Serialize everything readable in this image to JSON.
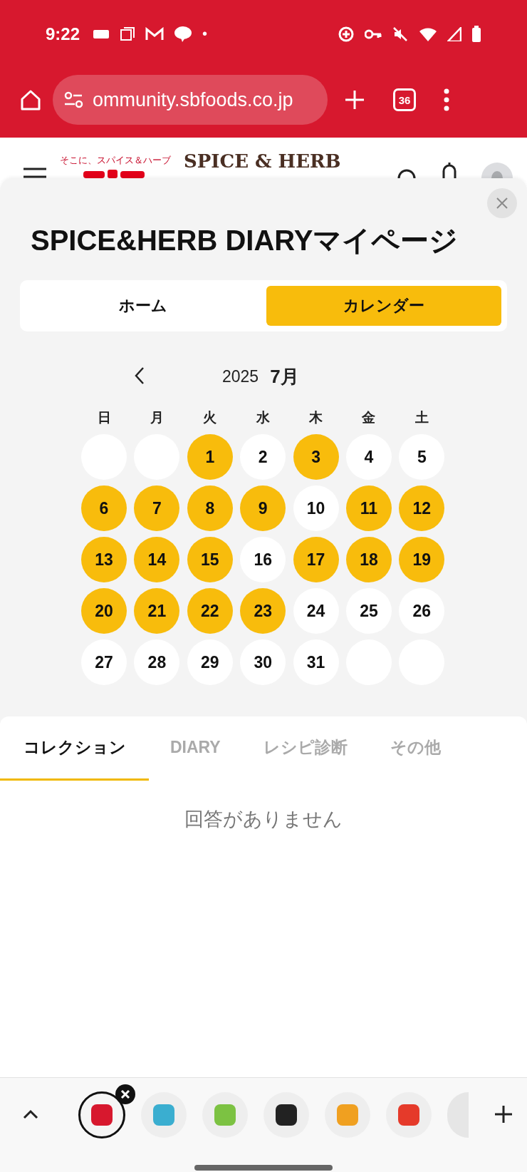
{
  "status_bar": {
    "time": "9:22",
    "notification_dot": "•"
  },
  "browser": {
    "url": "ommunity.sbfoods.co.jp",
    "tab_count": "36"
  },
  "site_header": {
    "tagline": "そこに、スパイス＆ハーブ",
    "brand": "SPICE & HERB"
  },
  "sheet": {
    "title": "SPICE&HERB DIARYマイページ",
    "segments": [
      {
        "label": "ホーム",
        "selected": false
      },
      {
        "label": "カレンダー",
        "selected": true
      }
    ],
    "calendar": {
      "year": "2025",
      "month": "7月",
      "weekdays": [
        "日",
        "月",
        "火",
        "水",
        "木",
        "金",
        "土"
      ],
      "days": [
        {
          "kind": "blank"
        },
        {
          "kind": "blank"
        },
        {
          "kind": "day",
          "day": "1",
          "marked": true
        },
        {
          "kind": "day",
          "day": "2",
          "marked": false
        },
        {
          "kind": "day",
          "day": "3",
          "marked": true
        },
        {
          "kind": "day",
          "day": "4",
          "marked": false
        },
        {
          "kind": "day",
          "day": "5",
          "marked": false
        },
        {
          "kind": "day",
          "day": "6",
          "marked": true
        },
        {
          "kind": "day",
          "day": "7",
          "marked": true
        },
        {
          "kind": "day",
          "day": "8",
          "marked": true
        },
        {
          "kind": "day",
          "day": "9",
          "marked": true
        },
        {
          "kind": "day",
          "day": "10",
          "marked": false
        },
        {
          "kind": "day",
          "day": "11",
          "marked": true
        },
        {
          "kind": "day",
          "day": "12",
          "marked": true
        },
        {
          "kind": "day",
          "day": "13",
          "marked": true
        },
        {
          "kind": "day",
          "day": "14",
          "marked": true
        },
        {
          "kind": "day",
          "day": "15",
          "marked": true
        },
        {
          "kind": "day",
          "day": "16",
          "marked": false
        },
        {
          "kind": "day",
          "day": "17",
          "marked": true
        },
        {
          "kind": "day",
          "day": "18",
          "marked": true
        },
        {
          "kind": "day",
          "day": "19",
          "marked": true
        },
        {
          "kind": "day",
          "day": "20",
          "marked": true
        },
        {
          "kind": "day",
          "day": "21",
          "marked": true
        },
        {
          "kind": "day",
          "day": "22",
          "marked": true
        },
        {
          "kind": "day",
          "day": "23",
          "marked": true
        },
        {
          "kind": "day",
          "day": "24",
          "marked": false
        },
        {
          "kind": "day",
          "day": "25",
          "marked": false
        },
        {
          "kind": "day",
          "day": "26",
          "marked": false
        },
        {
          "kind": "day",
          "day": "27",
          "marked": false
        },
        {
          "kind": "day",
          "day": "28",
          "marked": false
        },
        {
          "kind": "day",
          "day": "29",
          "marked": false
        },
        {
          "kind": "day",
          "day": "30",
          "marked": false
        },
        {
          "kind": "day",
          "day": "31",
          "marked": false
        },
        {
          "kind": "blank"
        },
        {
          "kind": "blank"
        }
      ]
    },
    "tabs": [
      {
        "label": "コレクション",
        "selected": true
      },
      {
        "label": "DIARY",
        "selected": false
      },
      {
        "label": "レシピ診断",
        "selected": false
      },
      {
        "label": "その他",
        "selected": false
      }
    ],
    "empty_message": "回答がありません"
  },
  "tab_strip": {
    "tabs": [
      {
        "selected": true
      },
      {
        "selected": false
      },
      {
        "selected": false
      },
      {
        "selected": false
      },
      {
        "selected": false
      },
      {
        "selected": false
      },
      {
        "selected": false
      }
    ]
  }
}
